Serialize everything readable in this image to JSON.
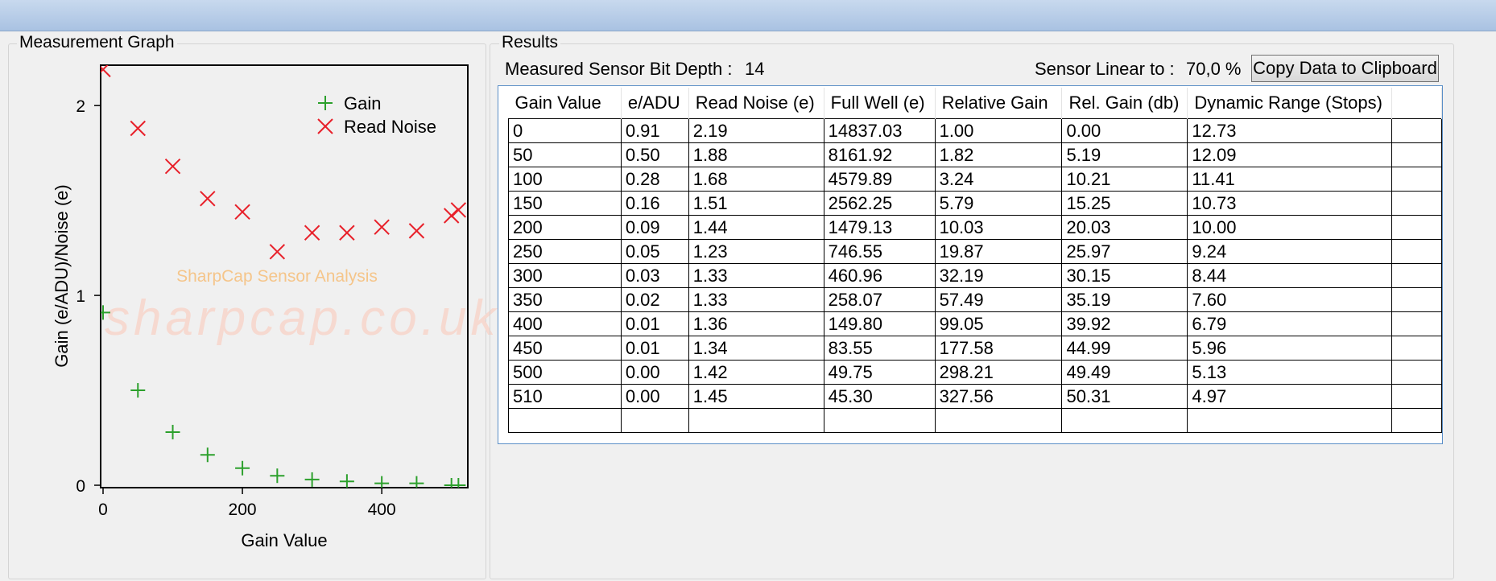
{
  "graph_panel": {
    "title": "Measurement Graph"
  },
  "results_panel": {
    "title": "Results",
    "bit_depth_label": "Measured Sensor Bit Depth :",
    "bit_depth_value": "14",
    "linear_label": "Sensor Linear to :",
    "linear_value": "70,0 %",
    "copy_button_label": "Copy Data to Clipboard"
  },
  "results_table": {
    "columns": [
      "Gain Value",
      "e/ADU",
      "Read Noise (e)",
      "Full Well (e)",
      "Relative Gain",
      "Rel. Gain (db)",
      "Dynamic Range (Stops)",
      ""
    ],
    "rows": [
      [
        "0",
        "0.91",
        "2.19",
        "14837.03",
        "1.00",
        "0.00",
        "12.73",
        ""
      ],
      [
        "50",
        "0.50",
        "1.88",
        "8161.92",
        "1.82",
        "5.19",
        "12.09",
        ""
      ],
      [
        "100",
        "0.28",
        "1.68",
        "4579.89",
        "3.24",
        "10.21",
        "11.41",
        ""
      ],
      [
        "150",
        "0.16",
        "1.51",
        "2562.25",
        "5.79",
        "15.25",
        "10.73",
        ""
      ],
      [
        "200",
        "0.09",
        "1.44",
        "1479.13",
        "10.03",
        "20.03",
        "10.00",
        ""
      ],
      [
        "250",
        "0.05",
        "1.23",
        "746.55",
        "19.87",
        "25.97",
        "9.24",
        ""
      ],
      [
        "300",
        "0.03",
        "1.33",
        "460.96",
        "32.19",
        "30.15",
        "8.44",
        ""
      ],
      [
        "350",
        "0.02",
        "1.33",
        "258.07",
        "57.49",
        "35.19",
        "7.60",
        ""
      ],
      [
        "400",
        "0.01",
        "1.36",
        "149.80",
        "99.05",
        "39.92",
        "6.79",
        ""
      ],
      [
        "450",
        "0.01",
        "1.34",
        "83.55",
        "177.58",
        "44.99",
        "5.96",
        ""
      ],
      [
        "500",
        "0.00",
        "1.42",
        "49.75",
        "298.21",
        "49.49",
        "5.13",
        ""
      ],
      [
        "510",
        "0.00",
        "1.45",
        "45.30",
        "327.56",
        "50.31",
        "4.97",
        ""
      ],
      [
        "",
        "",
        "",
        "",
        "",
        "",
        "",
        ""
      ]
    ]
  },
  "watermark": "sharpcap.co.uk",
  "colors": {
    "gain": "#2ca02c",
    "read_noise": "#e8202a",
    "chart_label": "#f5c58a"
  },
  "chart_data": {
    "type": "scatter",
    "title": "",
    "xlabel": "Gain Value",
    "ylabel": "Gain (e/ADU)/Noise (e)",
    "xlim": [
      0,
      520
    ],
    "ylim": [
      0,
      2.2
    ],
    "x_ticks": [
      "0",
      "200",
      "400"
    ],
    "y_ticks": [
      "0",
      "1",
      "2"
    ],
    "annotation": "SharpCap Sensor Analysis",
    "legend_position": "top-right",
    "grid": false,
    "x": [
      0,
      50,
      100,
      150,
      200,
      250,
      300,
      350,
      400,
      450,
      500,
      510
    ],
    "series": [
      {
        "name": "Gain",
        "marker": "plus",
        "values": [
          0.91,
          0.5,
          0.28,
          0.16,
          0.09,
          0.05,
          0.03,
          0.02,
          0.01,
          0.01,
          0.0,
          0.0
        ]
      },
      {
        "name": "Read Noise",
        "marker": "cross",
        "values": [
          2.19,
          1.88,
          1.68,
          1.51,
          1.44,
          1.23,
          1.33,
          1.33,
          1.36,
          1.34,
          1.42,
          1.45
        ]
      }
    ]
  }
}
